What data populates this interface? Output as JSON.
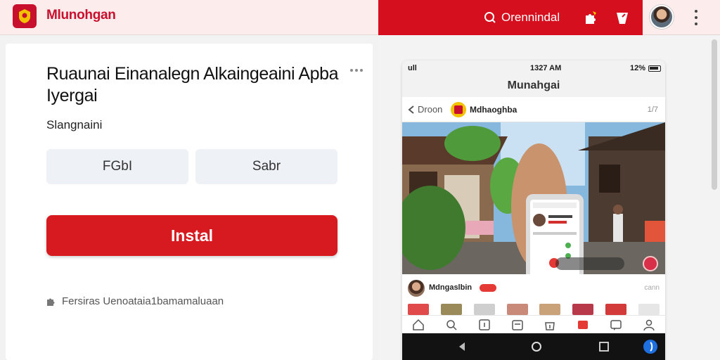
{
  "header": {
    "brand": "Mlunohgan",
    "search_label": "Orennindal",
    "logo_icon": "crest-logo-icon",
    "icons": [
      "search-icon",
      "puzzle-icon",
      "shopping-bag-icon",
      "user-avatar",
      "kebab-menu-icon"
    ]
  },
  "main": {
    "title": "Ruaunai Einanalegn Alkaingeaini Apba Iyergai",
    "subtitle": "Slangnaini",
    "option_left": "FGbI",
    "option_right": "Sabr",
    "install_label": "Instal",
    "footnote": "Fersiras Uenoataia1bamamaluaan",
    "footnote_icon": "puzzle-icon"
  },
  "phone": {
    "status_left": "ull",
    "status_time": "1327 AM",
    "status_right": "12%",
    "app_title": "Munahgai",
    "back_label": "Droon",
    "channel_name": "Mdhaoghba",
    "channel_count": "1/7",
    "post_name": "Mdngaslbin",
    "post_right": "cann"
  },
  "colors": {
    "accent_red": "#d50f1e",
    "install_red": "#d71920",
    "brand_red": "#c8102e"
  }
}
